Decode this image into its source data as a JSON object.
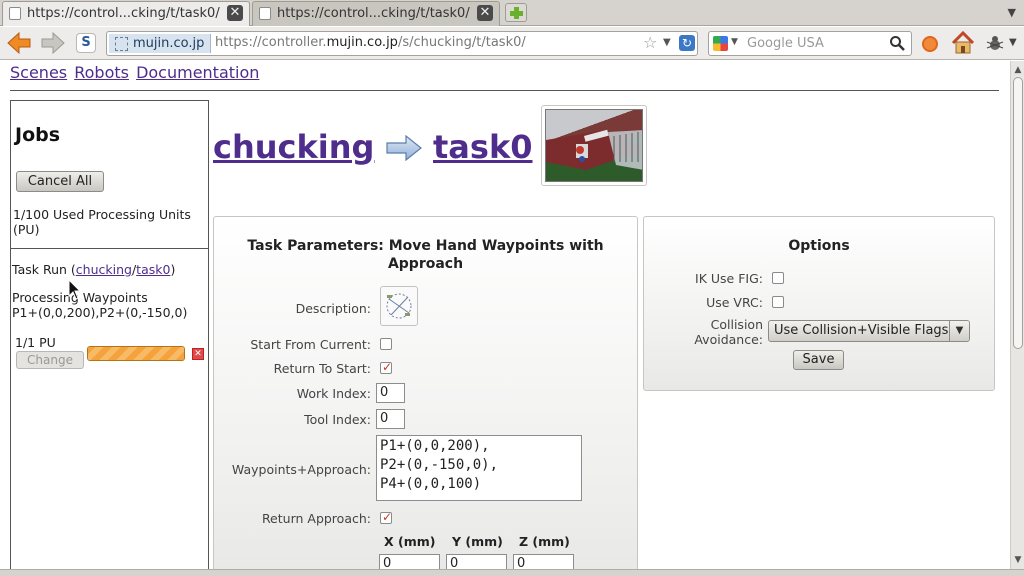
{
  "browser": {
    "tabs": [
      {
        "title": "https://control...cking/t/task0/",
        "active": true
      },
      {
        "title": "https://control...cking/t/task0/",
        "active": false
      }
    ],
    "site_identity": "mujin.co.jp",
    "url_prefix": "https://controller.",
    "url_domain": "mujin.co.jp",
    "url_suffix": "/s/chucking/t/task0/",
    "search_placeholder": "Google USA"
  },
  "topnav": {
    "scenes": "Scenes",
    "robots": "Robots",
    "documentation": "Documentation"
  },
  "jobs": {
    "title": "Jobs",
    "cancel_all": "Cancel All",
    "pu_used": "1/100 Used Processing Units (PU)",
    "task_run_prefix": "Task Run (",
    "task_run_scene": "chucking",
    "task_run_sep": "/",
    "task_run_task": "task0",
    "task_run_suffix": ")",
    "processing_line1": "Processing Waypoints",
    "processing_line2": "P1+(0,0,200),P2+(0,-150,0)",
    "job_pu": "1/1 PU",
    "change": "Change",
    "progress": 1.0
  },
  "header": {
    "scene": "chucking",
    "task": "task0"
  },
  "params": {
    "title": "Task Parameters: Move Hand Waypoints with Approach",
    "description_label": "Description:",
    "start_from_current_label": "Start From Current:",
    "start_from_current": false,
    "return_to_start_label": "Return To Start:",
    "return_to_start": true,
    "work_index_label": "Work Index:",
    "work_index": "0",
    "tool_index_label": "Tool Index:",
    "tool_index": "0",
    "waypoints_label": "Waypoints+Approach:",
    "waypoints": [
      "P1+(0,0,200),",
      "P2+(0,-150,0),",
      "P4+(0,0,100)"
    ],
    "return_approach_label": "Return Approach:",
    "return_approach": true,
    "x_label": "X (mm)",
    "y_label": "Y (mm)",
    "z_label": "Z (mm)",
    "x": "0",
    "y": "0",
    "z": "0"
  },
  "options": {
    "title": "Options",
    "ik_use_fig_label": "IK Use FIG:",
    "ik_use_fig": false,
    "use_vrc_label": "Use VRC:",
    "use_vrc": false,
    "collision_label_1": "Collision",
    "collision_label_2": "Avoidance:",
    "collision_value": "Use Collision+Visible Flags",
    "save": "Save"
  },
  "colors": {
    "link": "#4e2d8c",
    "progress": "#f5a23c",
    "check": "#c0392b"
  }
}
